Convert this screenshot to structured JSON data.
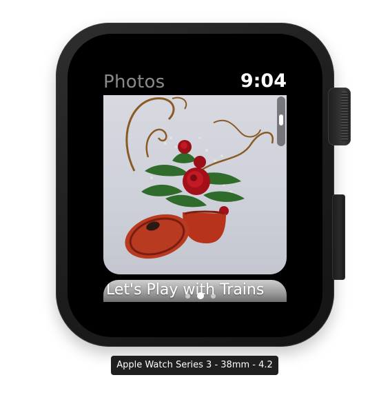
{
  "watch_face": {
    "app_title": "Photos",
    "time": "9:04"
  },
  "photo": {
    "subject": "red-roses-arrangement-icon",
    "scroll_position": 0.35
  },
  "next_album": {
    "title": "Let's Play with Trains"
  },
  "page_indicator": {
    "count": 3,
    "active_index": 1
  },
  "simulator": {
    "device_label": "Apple Watch Series 3 - 38mm - 4.2"
  },
  "colors": {
    "case": "#1c1c1c",
    "screen": "#000000",
    "title_text": "#8a8a8a",
    "time_text": "#ffffff",
    "rose_red": "#b0121a",
    "pot_red": "#b8331c",
    "foliage": "#2f6b2a",
    "photo_background": "#d2d4dc",
    "label_background": "#1f1f1f"
  }
}
